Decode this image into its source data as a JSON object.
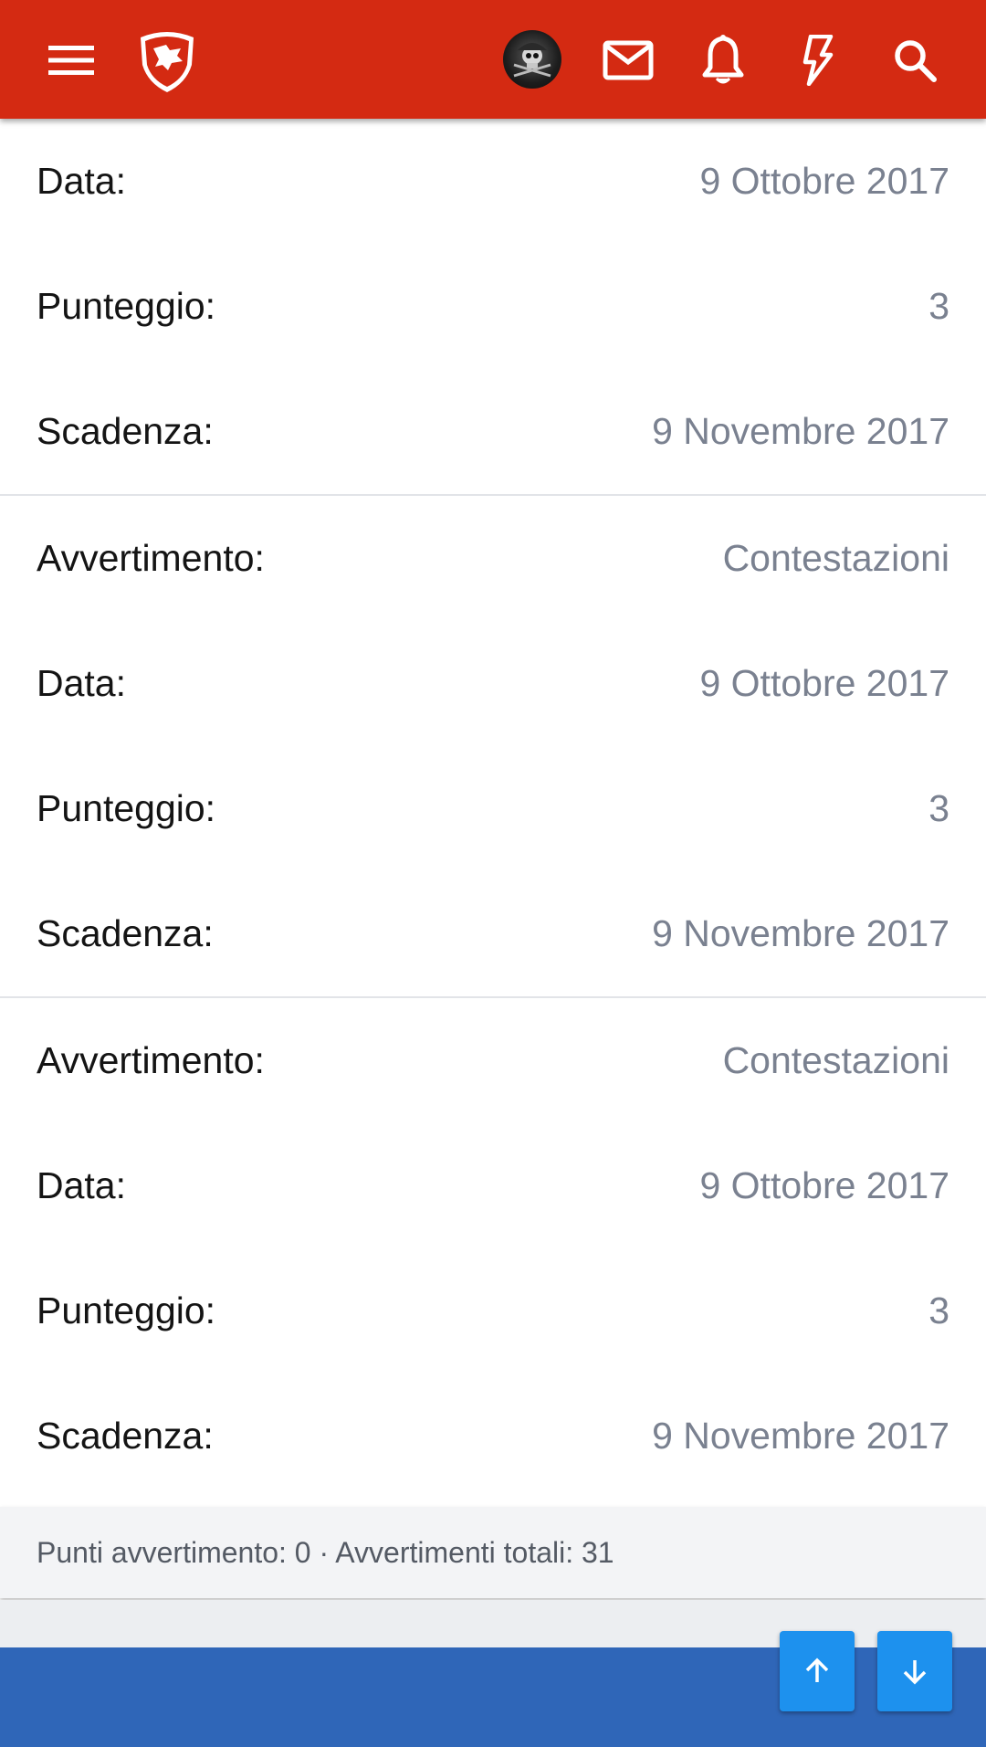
{
  "header": {
    "menu_icon": "hamburger-menu-icon",
    "logo_icon": "site-shield-logo-icon",
    "avatar_icon": "user-avatar",
    "mail_icon": "mail-icon",
    "bell_icon": "bell-icon",
    "bolt_icon": "lightning-bolt-icon",
    "search_icon": "search-icon",
    "color": "#d42a12"
  },
  "warnings": [
    {
      "rows": [
        {
          "label": "Data:",
          "value": "9 Ottobre 2017"
        },
        {
          "label": "Punteggio:",
          "value": "3"
        },
        {
          "label": "Scadenza:",
          "value": "9 Novembre 2017"
        }
      ]
    },
    {
      "rows": [
        {
          "label": "Avvertimento:",
          "value": "Contestazioni"
        },
        {
          "label": "Data:",
          "value": "9 Ottobre 2017"
        },
        {
          "label": "Punteggio:",
          "value": "3"
        },
        {
          "label": "Scadenza:",
          "value": "9 Novembre 2017"
        }
      ]
    },
    {
      "rows": [
        {
          "label": "Avvertimento:",
          "value": "Contestazioni"
        },
        {
          "label": "Data:",
          "value": "9 Ottobre 2017"
        },
        {
          "label": "Punteggio:",
          "value": "3"
        },
        {
          "label": "Scadenza:",
          "value": "9 Novembre 2017"
        }
      ]
    }
  ],
  "summary": "Punti avvertimento: 0 · Avvertimenti totali: 31",
  "scroll_controls": {
    "up_icon": "arrow-up-icon",
    "down_icon": "arrow-down-icon",
    "color": "#1d91ee"
  },
  "footer_color": "#2f66b8"
}
